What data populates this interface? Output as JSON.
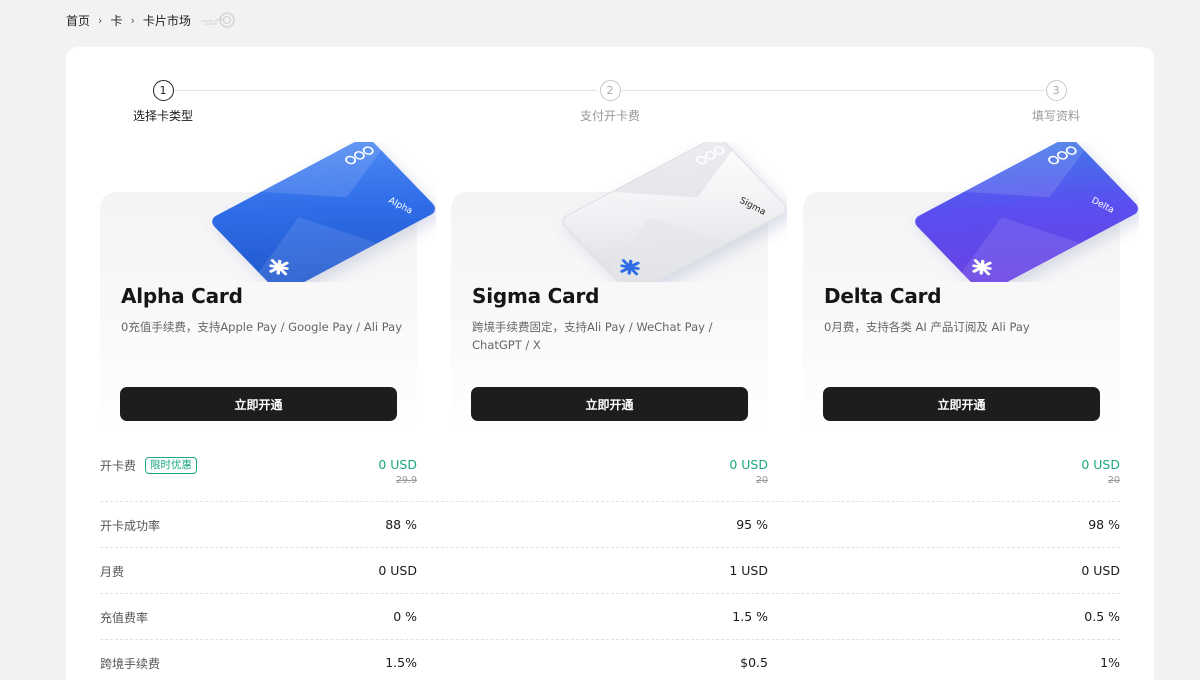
{
  "breadcrumb": {
    "home": "首页",
    "card": "卡",
    "market": "卡片市场"
  },
  "steps": [
    {
      "num": "1",
      "label": "选择卡类型",
      "active": true
    },
    {
      "num": "2",
      "label": "支付开卡费",
      "active": false
    },
    {
      "num": "3",
      "label": "填写资料",
      "active": false
    }
  ],
  "cards": [
    {
      "name": "Alpha Card",
      "art_label": "Alpha",
      "desc": "0充值手续费，支持Apple Pay / Google Pay / Ali Pay",
      "button": "立即开通",
      "color_main": "#2f6de8",
      "color_light": "#4f8bf5",
      "color_dark": "#1f55c8"
    },
    {
      "name": "Sigma Card",
      "art_label": "Sigma",
      "desc": "跨境手续费固定，支持Ali Pay / WeChat Pay / ChatGPT / X",
      "button": "立即开通",
      "color_main": "#f1f2f4",
      "color_light": "#ffffff",
      "color_dark": "#d9dbe0"
    },
    {
      "name": "Delta Card",
      "art_label": "Delta",
      "desc": "0月费，支持各类 AI 产品订阅及 Ali Pay",
      "button": "立即开通",
      "color_main": "#5a4ff0",
      "color_light": "#3f7be8",
      "color_dark": "#6b3ee0"
    }
  ],
  "table": {
    "promo_badge": "限时优惠",
    "rows": [
      {
        "label": "开卡费",
        "values": [
          "0 USD",
          "0 USD",
          "0 USD"
        ],
        "original": [
          "29.9",
          "20",
          "20"
        ]
      },
      {
        "label": "开卡成功率",
        "values": [
          "88 %",
          "95 %",
          "98 %"
        ]
      },
      {
        "label": "月费",
        "values": [
          "0 USD",
          "1 USD",
          "0 USD"
        ]
      },
      {
        "label": "充值费率",
        "values": [
          "0 %",
          "1.5 %",
          "0.5 %"
        ]
      },
      {
        "label": "跨境手续费",
        "values": [
          "1.5%",
          "$0.5",
          "1%"
        ]
      }
    ]
  },
  "colors": {
    "accent_green": "#1aa882",
    "button_dark": "#1d1d1d"
  }
}
